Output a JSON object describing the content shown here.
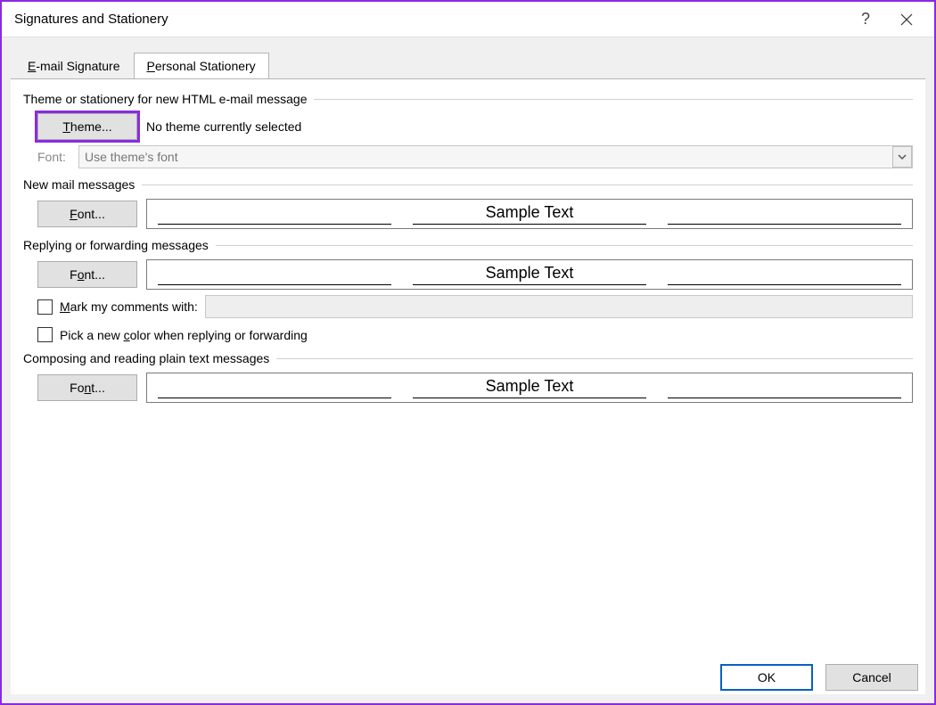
{
  "titlebar": {
    "title": "Signatures and Stationery",
    "help_label": "?",
    "close_label": "×"
  },
  "tabs": {
    "email_sig_prefix": "E",
    "email_sig_rest": "-mail Signature",
    "pers_stat_prefix": "P",
    "pers_stat_rest": "ersonal Stationery"
  },
  "theme_group": {
    "legend": "Theme or stationery for new HTML e-mail message",
    "theme_btn_prefix": "T",
    "theme_btn_rest": "heme...",
    "status_text": "No theme currently selected",
    "font_label": "Font:",
    "font_select_value": "Use theme's font"
  },
  "newmail_group": {
    "legend": "New mail messages",
    "font_btn_prefix": "F",
    "font_btn_rest": "ont...",
    "sample": "Sample Text"
  },
  "reply_group": {
    "legend": "Replying or forwarding messages",
    "font_btn_pre": "F",
    "font_btn_ul": "o",
    "font_btn_post": "nt...",
    "sample": "Sample Text",
    "mark_prefix": "M",
    "mark_rest": "ark my comments with:",
    "mark_value": "",
    "pick_pre": "Pick a new ",
    "pick_ul": "c",
    "pick_post": "olor when replying or forwarding"
  },
  "plain_group": {
    "legend": "Composing and reading plain text messages",
    "font_btn_pre": "Fo",
    "font_btn_ul": "n",
    "font_btn_post": "t...",
    "sample": "Sample Text"
  },
  "footer": {
    "ok": "OK",
    "cancel": "Cancel"
  }
}
